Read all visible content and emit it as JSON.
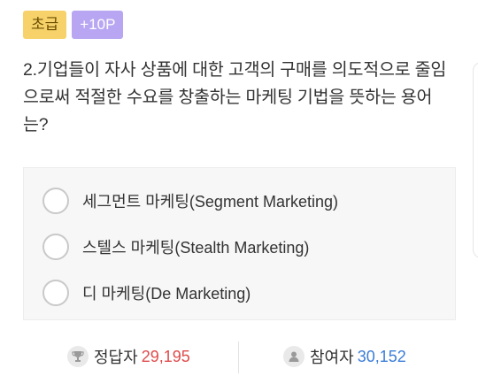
{
  "badges": {
    "level": "초급",
    "points": "+10P"
  },
  "question": {
    "text": "2.기업들이 자사 상품에 대한 고객의 구매를 의도적으로 줄임으로써 적절한 수요를 창출하는 마케팅 기법을 뜻하는 용어는?"
  },
  "options": [
    {
      "label": "세그먼트 마케팅(Segment Marketing)"
    },
    {
      "label": "스텔스 마케팅(Stealth Marketing)"
    },
    {
      "label": "디 마케팅(De Marketing)"
    }
  ],
  "stats": {
    "correct_label": "정답자",
    "correct_value": "29,195",
    "correct_icon": "trophy-icon",
    "participants_label": "참여자",
    "participants_value": "30,152",
    "participants_icon": "person-icon"
  },
  "colors": {
    "level_badge": "#f7d26a",
    "points_badge": "#b8a6f2",
    "correct_value": "#e04b4b",
    "participants_value": "#3b7dd8"
  }
}
